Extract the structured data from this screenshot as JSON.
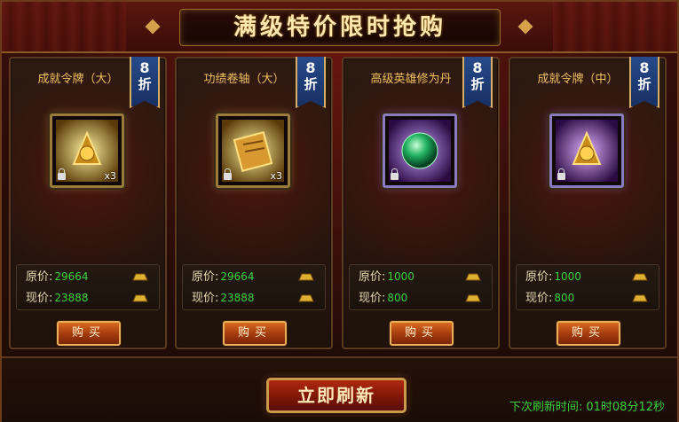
{
  "title": "满级特价限时抢购",
  "discount": {
    "number": "8",
    "unit": "折"
  },
  "price_labels": {
    "original": "原价:",
    "current": "现价:"
  },
  "buy_label": "购买",
  "refresh_button": "立即刷新",
  "refresh_timer": "下次刷新时间: 01时08分12秒",
  "items": [
    {
      "name": "成就令牌（大）",
      "qty": "x3",
      "original": "29664",
      "current": "23888",
      "icon": "gold-medal-icon",
      "frame": "gold"
    },
    {
      "name": "功绩卷轴（大）",
      "qty": "x3",
      "original": "29664",
      "current": "23888",
      "icon": "gold-scroll-icon",
      "frame": "gold"
    },
    {
      "name": "高级英雄修为丹",
      "qty": "",
      "original": "1000",
      "current": "800",
      "icon": "green-orb-icon",
      "frame": "purple"
    },
    {
      "name": "成就令牌（中）",
      "qty": "",
      "original": "1000",
      "current": "800",
      "icon": "purple-medal-icon",
      "frame": "purple"
    }
  ]
}
